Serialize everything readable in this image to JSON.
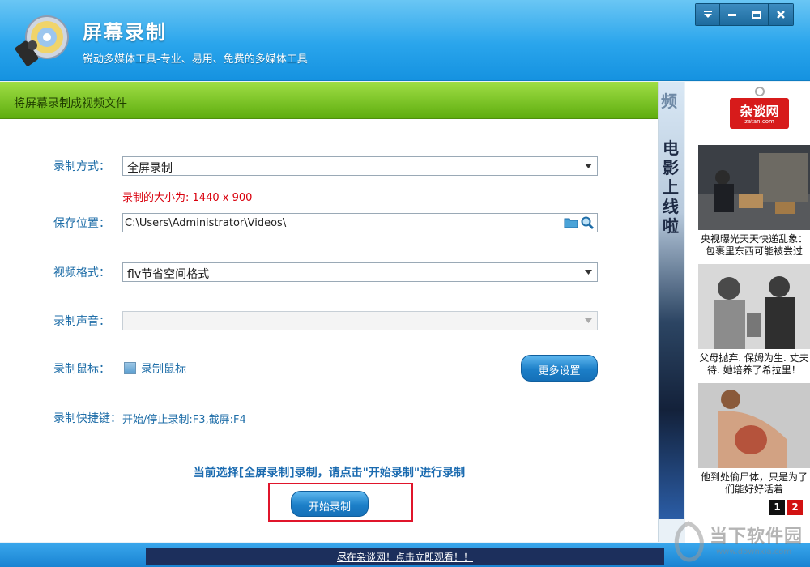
{
  "app": {
    "title": "屏幕录制",
    "subtitle": "锐动多媒体工具-专业、易用、免费的多媒体工具"
  },
  "window_controls": [
    "menu-icon",
    "minimize-icon",
    "maximize-icon",
    "close-icon"
  ],
  "section": {
    "title": "将屏幕录制成视频文件"
  },
  "form": {
    "record_mode": {
      "label": "录制方式：",
      "value": "全屏录制"
    },
    "record_size": {
      "label": "录制的大小为:",
      "value": "1440 x 900"
    },
    "save_path": {
      "label": "保存位置：",
      "value": "C:\\Users\\Administrator\\Videos\\"
    },
    "video_format": {
      "label": "视频格式：",
      "value": "flv节省空间格式"
    },
    "record_audio": {
      "label": "录制声音：",
      "value": ""
    },
    "record_mouse": {
      "label": "录制鼠标：",
      "checkbox_label": "录制鼠标",
      "checked": true
    },
    "more_settings_label": "更多设置",
    "hotkey": {
      "label": "录制快捷键：",
      "value": "开始/停止录制:F3,截屏:F4"
    }
  },
  "hint": "当前选择[全屏录制]录制，请点击\"开始录制\"进行录制",
  "start_button_label": "开始录制",
  "ad": {
    "strip_top": "频",
    "strip_text": "电影上线啦",
    "logo": "杂谈网",
    "logo_url": "zatan.com",
    "items": [
      {
        "caption_line1": "央视曝光天天快递乱象：",
        "caption_line2": "包裹里东西可能被尝过"
      },
      {
        "caption_line1": "父母抛弃. 保姆为生. 丈夫",
        "caption_line2": "待. 她培养了希拉里！"
      },
      {
        "caption_line1": "他到处偷尸体，只是为了",
        "caption_line2": "们能好好活着"
      }
    ],
    "pages": [
      "1",
      "2"
    ]
  },
  "footer": {
    "text": "尽在杂谈网！点击立即观看！！"
  },
  "watermark": {
    "text": "当下软件园",
    "url": "www.downxia.com"
  },
  "colors": {
    "header": "#2aa5ec",
    "section_bar": "#7bc524",
    "label": "#1f6ea8",
    "size_text": "#d9000d",
    "highlight": "#e0152b"
  }
}
